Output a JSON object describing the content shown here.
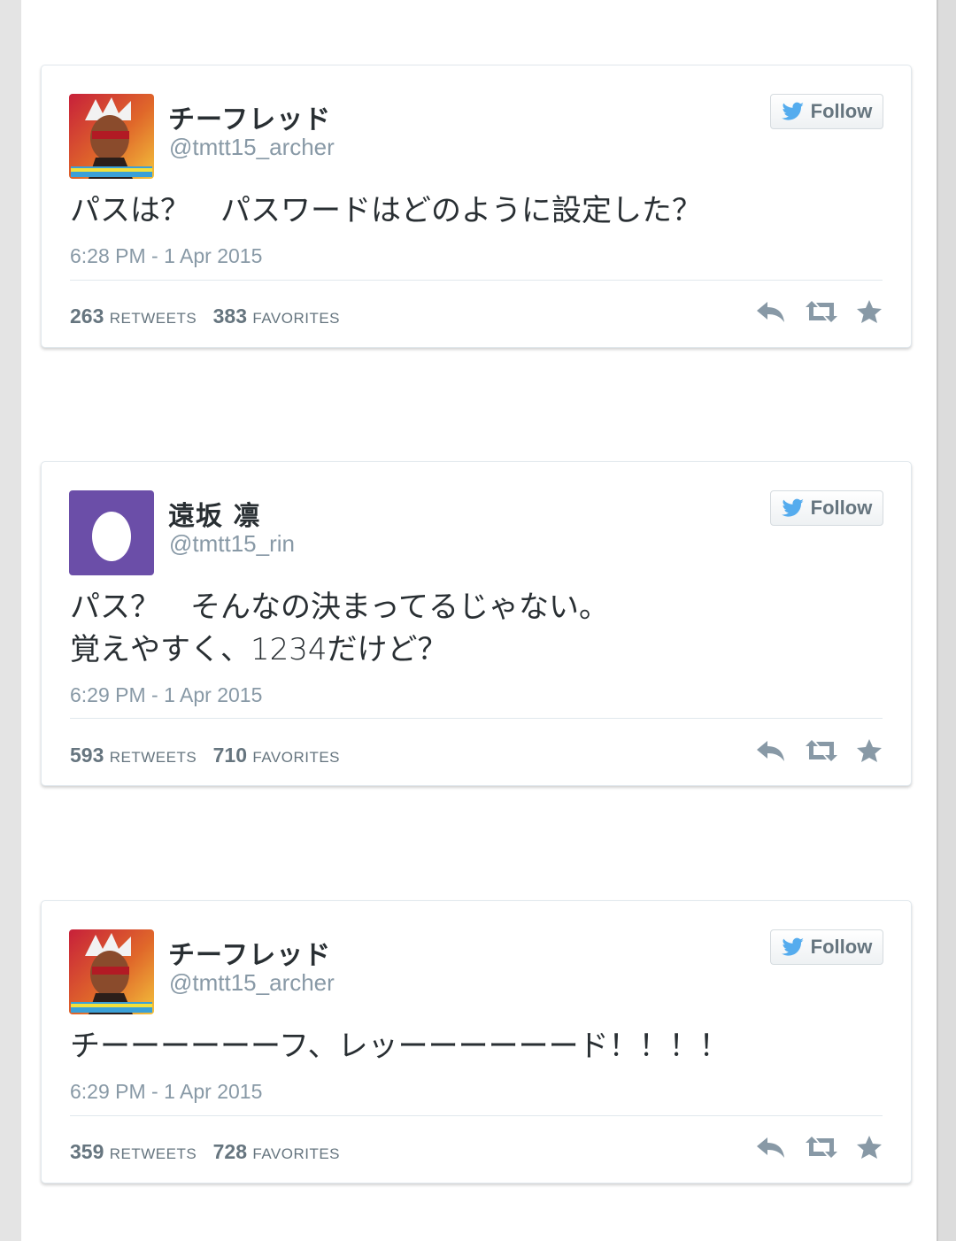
{
  "tweets": [
    {
      "avatar": "archer-avatar",
      "display_name": "チーフレッド",
      "handle": "@tmtt15_archer",
      "follow_label": "Follow",
      "text_lines": [
        "パスは？　パスワードはどのように設定した？"
      ],
      "timestamp": "6:28 PM - 1 Apr 2015",
      "retweets": "263",
      "retweets_label": "RETWEETS",
      "favorites": "383",
      "favorites_label": "FAVORITES"
    },
    {
      "avatar": "egg-avatar",
      "display_name": "遠坂 凛",
      "handle": "@tmtt15_rin",
      "follow_label": "Follow",
      "text_lines": [
        "パス？　そんなの決まってるじゃない。",
        "覚えやすく、1234だけど？"
      ],
      "timestamp": "6:29 PM - 1 Apr 2015",
      "retweets": "593",
      "retweets_label": "RETWEETS",
      "favorites": "710",
      "favorites_label": "FAVORITES"
    },
    {
      "avatar": "archer-avatar",
      "display_name": "チーフレッド",
      "handle": "@tmtt15_archer",
      "follow_label": "Follow",
      "text_lines": [
        "チーーーーーーフ、レッーーーーーード！！！！"
      ],
      "timestamp": "6:29 PM - 1 Apr 2015",
      "retweets": "359",
      "retweets_label": "RETWEETS",
      "favorites": "728",
      "favorites_label": "FAVORITES"
    }
  ],
  "colors": {
    "twitter_blue": "#55acee",
    "egg_background": "#6b4ea8",
    "text": "#292f33",
    "muted": "#8899a6"
  },
  "icons": [
    "twitter-bird-icon",
    "reply-icon",
    "retweet-icon",
    "favorite-star-icon"
  ]
}
